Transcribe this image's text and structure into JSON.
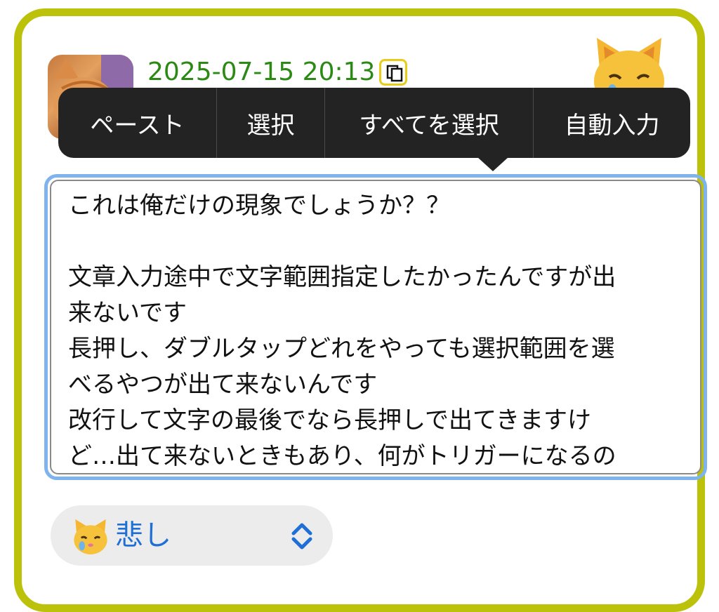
{
  "post": {
    "timestamp": "2025-07-15 20:13",
    "avatar_icon": "cat-photo",
    "copy_icon": "copy-icon",
    "mood_icon": "crying-cat-face-icon"
  },
  "context_menu": {
    "items": [
      {
        "label": "ペースト"
      },
      {
        "label": "選択"
      },
      {
        "label": "すべてを選択"
      },
      {
        "label": "自動入力"
      }
    ]
  },
  "editor": {
    "lines": [
      "これは俺だけの現象でしょうか？？",
      "",
      "文章入力途中で文字範囲指定したかったんですが出",
      "来ないです",
      "長押し、ダブルタップどれをやっても選択範囲を選",
      "べるやつが出て来ないんです",
      "改行して文字の最後でなら長押しで出てきますけ",
      "ど…出て来ないときもあり、何がトリガーになるの"
    ]
  },
  "mood_select": {
    "selected_label": "悲し",
    "icon": "crying-cat-face-icon",
    "chevron_icon": "chevron-up-down-icon"
  },
  "colors": {
    "card_border": "#bcc10a",
    "timestamp": "#2a8a14",
    "popup_bg": "#232323",
    "focus_ring": "#7fb3ee",
    "select_text": "#1f6fd6"
  }
}
